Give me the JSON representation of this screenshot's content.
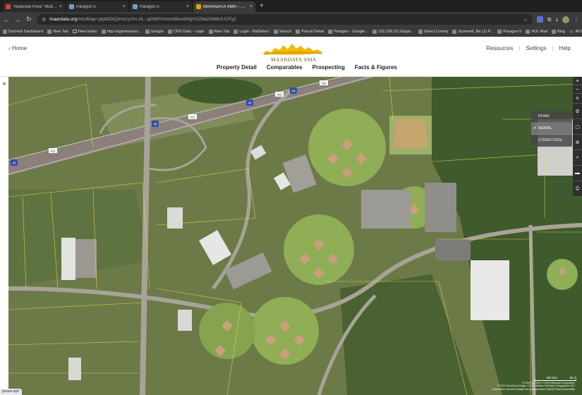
{
  "browser": {
    "tabs": [
      {
        "title": "\"Reduced Price\" Multi-Purpo",
        "favicon_color": "#d44638"
      },
      {
        "title": "Paragon 5",
        "favicon_color": "#7a9cc6"
      },
      {
        "title": "Paragon 5",
        "favicon_color": "#7a9cc6"
      },
      {
        "title": "MAARDATA XMA – Property",
        "favicon_color": "#e0a800",
        "active": true
      }
    ],
    "new_tab_symbol": "+",
    "url_host": "maardata.org",
    "url_path": "/mls/Map/-gtpb3DQ3mk1yVm-XL--qlX8RYAmm98eu9i4gVGZ6eZ0498JUCFg2",
    "bookmarks": [
      {
        "label": "DocHub Dashboard",
        "type": "site"
      },
      {
        "label": "New Tab",
        "type": "site"
      },
      {
        "label": "New folder",
        "type": "folder"
      },
      {
        "label": "http://agentresour...",
        "type": "site"
      },
      {
        "label": "Google",
        "type": "site"
      },
      {
        "label": "CRS Data - Login",
        "type": "site"
      },
      {
        "label": "New Tab",
        "type": "site"
      },
      {
        "label": "Login - BidSelect",
        "type": "site"
      },
      {
        "label": "Search",
        "type": "site"
      },
      {
        "label": "Parcel Detail",
        "type": "site"
      },
      {
        "label": "Paragon - Google...",
        "type": "site"
      },
      {
        "label": "192.168.33.1/login...",
        "type": "site"
      },
      {
        "label": "Select County",
        "type": "site"
      },
      {
        "label": "Scanned_file (1).P...",
        "type": "site"
      },
      {
        "label": "Paragon 5",
        "type": "site"
      },
      {
        "label": "AOL Mail",
        "type": "site"
      },
      {
        "label": "Bing",
        "type": "site"
      }
    ],
    "all_bookmarks_label": "All Bookmarks"
  },
  "header": {
    "home_label": "Home",
    "logo_text": "MAARDATA XMA",
    "util_links": [
      "Resources",
      "Settings",
      "Help"
    ],
    "nav": [
      "Property Detail",
      "Comparables",
      "Prospecting",
      "Facts & Figures"
    ]
  },
  "map": {
    "layers": [
      {
        "label": "ROAD",
        "selected": false
      },
      {
        "label": "AERIAL",
        "selected": true
      },
      {
        "label": "STREETSIDE",
        "selected": false
      }
    ],
    "compass_label": "N",
    "road_labels": [
      "40",
      "40",
      "40",
      "40",
      "412",
      "412",
      "412",
      "412"
    ],
    "scale_labels": [
      "250 feet",
      "50 m"
    ],
    "copyright_lines": [
      "© 2024 TomTom, © 2024 Microsoft Corporation",
      "© 2024 Cnes/Spot Image, © 2024 Maxar, Earthstar Geographics SIO",
      "Information deemed reliable but not guaranteed. MAAR Data Accessibility"
    ]
  },
  "status_text": "javascript:"
}
